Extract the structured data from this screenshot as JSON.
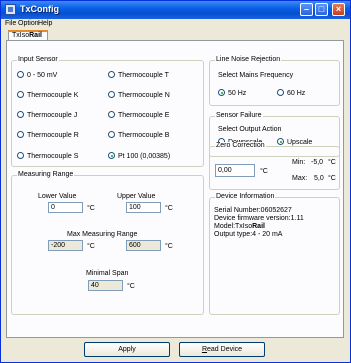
{
  "window": {
    "title": "TxConfig"
  },
  "menu": [
    "File",
    "Option",
    "Help"
  ],
  "tab": {
    "label_prefix": "TxIso",
    "label_bold": "Rail"
  },
  "input_sensor": {
    "title": "Input Sensor",
    "options": [
      {
        "label": "0 - 50 mV",
        "selected": false
      },
      {
        "label": "Thermocouple T",
        "selected": false
      },
      {
        "label": "Thermocouple K",
        "selected": false
      },
      {
        "label": "Thermocouple N",
        "selected": false
      },
      {
        "label": "Thermocouple J",
        "selected": false
      },
      {
        "label": "Thermocouple E",
        "selected": false
      },
      {
        "label": "Thermocouple R",
        "selected": false
      },
      {
        "label": "Thermocouple B",
        "selected": false
      },
      {
        "label": "Thermocouple S",
        "selected": false
      },
      {
        "label": "Pt 100 (0,00385)",
        "selected": true
      }
    ]
  },
  "line_noise": {
    "title": "Line Noise Rejection",
    "caption": "Select Mains Frequency",
    "options": [
      {
        "label": "50 Hz",
        "selected": true
      },
      {
        "label": "60 Hz",
        "selected": false
      }
    ]
  },
  "sensor_failure": {
    "title": "Sensor Failure",
    "caption": "Select Output Action",
    "options": [
      {
        "label": "Downscale",
        "selected": false
      },
      {
        "label": "Upscale",
        "selected": true
      }
    ]
  },
  "measuring_range": {
    "title": "Measuring Range",
    "lower_label": "Lower Value",
    "lower_value": "0",
    "upper_label": "Upper Value",
    "upper_value": "100",
    "unit": "°C",
    "max_label": "Max Measuring Range",
    "max_low": "-200",
    "max_high": "600",
    "span_label": "Minimal Span",
    "span_value": "40"
  },
  "zero_correction": {
    "title": "Zero Correction",
    "value": "0,00",
    "unit": "°C",
    "min_label": "Min:",
    "min_value": "-5,0",
    "max_label": "Max:",
    "max_value": "5,0"
  },
  "device_info": {
    "title": "Device Information",
    "serial": "Serial Number:06052627",
    "firmware": "Device firmware version:1.11",
    "model_prefix": "Model:TxIso",
    "model_bold": "Rail",
    "output": "Output type:4 - 20 mA"
  },
  "buttons": {
    "apply": "Apply",
    "read_device_first": "R",
    "read_device_rest": "ead Device"
  },
  "colors": {
    "title_bar": "#0a5fe6",
    "tab_highlight": "#e68b2c",
    "radio_dot": "#21a121"
  }
}
